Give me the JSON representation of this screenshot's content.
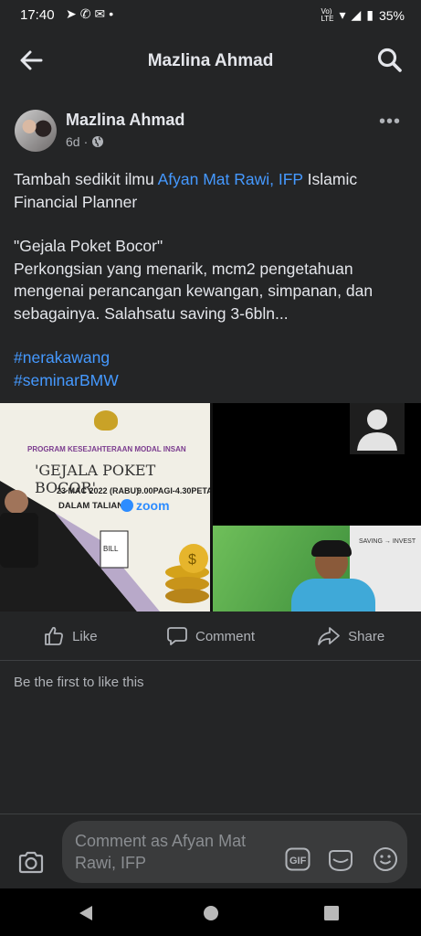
{
  "status_bar": {
    "time": "17:40",
    "left_icons": [
      "telegram-icon",
      "whatsapp-icon",
      "messenger-icon",
      "dot"
    ],
    "network": "Vo) LTE",
    "battery": "35%"
  },
  "header": {
    "title": "Mazlina Ahmad"
  },
  "post": {
    "author": "Mazlina Ahmad",
    "time": "6d",
    "privacy_icon": "globe-icon",
    "line1_prefix": "Tambah sedikit ilmu ",
    "line1_link": "Afyan Mat Rawi, IFP",
    "line1_suffix": "  Islamic Financial Planner",
    "quote": "\"Gejala Poket Bocor\"",
    "body": "Perkongsian yang menarik, mcm2 pengetahuan mengenai perancangan kewangan, simpanan, dan sebagainya. Salahsatu saving 3-6bln...",
    "hashtag1": "#nerakawang",
    "hashtag2": "#seminarBMW"
  },
  "media": {
    "program": "PROGRAM KESEJAHTERAAN MODAL INSAN",
    "title": "'GEJALA POKET BOCOR'",
    "date": "23 MAC 2022 (RABU)",
    "time": "9.00PAGI-4.30PETANG",
    "mode": "DALAM TALIAN",
    "platform": "zoom",
    "bill": "BILL",
    "whiteboard": "SAVING → INVEST"
  },
  "actions": {
    "like": "Like",
    "comment": "Comment",
    "share": "Share"
  },
  "likes_text": "Be the first to like this",
  "comment_bar": {
    "placeholder": "Comment as Afyan Mat Rawi, IFP",
    "gif": "GIF"
  }
}
